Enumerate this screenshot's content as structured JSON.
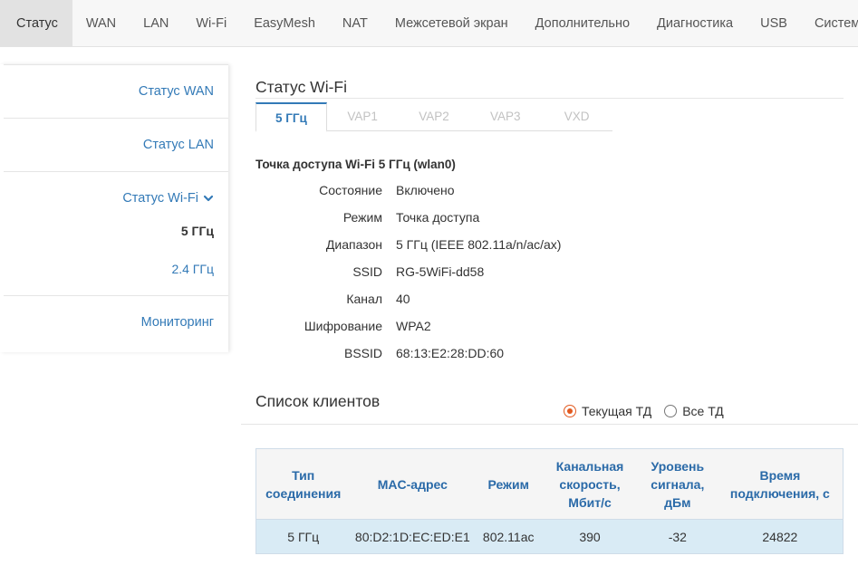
{
  "topnav": {
    "items": [
      {
        "label": "Статус",
        "active": true
      },
      {
        "label": "WAN"
      },
      {
        "label": "LAN"
      },
      {
        "label": "Wi-Fi"
      },
      {
        "label": "EasyMesh"
      },
      {
        "label": "NAT"
      },
      {
        "label": "Межсетевой экран"
      },
      {
        "label": "Дополнительно"
      },
      {
        "label": "Диагностика"
      },
      {
        "label": "USB"
      },
      {
        "label": "Система"
      }
    ]
  },
  "sidebar": {
    "wan_status": "Статус WAN",
    "lan_status": "Статус LAN",
    "wifi_status": "Статус Wi-Fi",
    "wifi_5": "5 ГГц",
    "wifi_24": "2.4 ГГц",
    "monitoring": "Мониторинг",
    "chevron_icon": "chevron-down-icon"
  },
  "main": {
    "title": "Статус Wi-Fi",
    "tabs": [
      {
        "label": "5 ГГц",
        "active": true
      },
      {
        "label": "VAP1"
      },
      {
        "label": "VAP2"
      },
      {
        "label": "VAP3"
      },
      {
        "label": "VXD"
      }
    ],
    "ap_title": "Точка доступа Wi-Fi 5 ГГц (wlan0)",
    "info": [
      {
        "label": "Состояние",
        "value": "Включено"
      },
      {
        "label": "Режим",
        "value": "Точка доступа"
      },
      {
        "label": "Диапазон",
        "value": "5 ГГц (IEEE 802.11a/n/ac/ax)"
      },
      {
        "label": "SSID",
        "value": "RG-5WiFi-dd58"
      },
      {
        "label": "Канал",
        "value": "40"
      },
      {
        "label": "Шифрование",
        "value": "WPA2"
      },
      {
        "label": "BSSID",
        "value": "68:13:E2:28:DD:60"
      }
    ],
    "clients": {
      "title": "Список клиентов",
      "radio_current": "Текущая ТД",
      "radio_all": "Все ТД",
      "radio_selected": "current",
      "accent_color": "#e2591f",
      "headers": [
        "Тип соединения",
        "MAC-адрес",
        "Режим",
        "Канальная скорость, Мбит/с",
        "Уровень сигнала, дБм",
        "Время подключения, с"
      ],
      "rows": [
        [
          "5 ГГц",
          "80:D2:1D:EC:ED:E1",
          "802.11ac",
          "390",
          "-32",
          "24822"
        ]
      ]
    }
  },
  "colors": {
    "link": "#337ab7",
    "row_highlight": "#d9ebf5",
    "nav_active_bg": "#e2e2e2"
  }
}
